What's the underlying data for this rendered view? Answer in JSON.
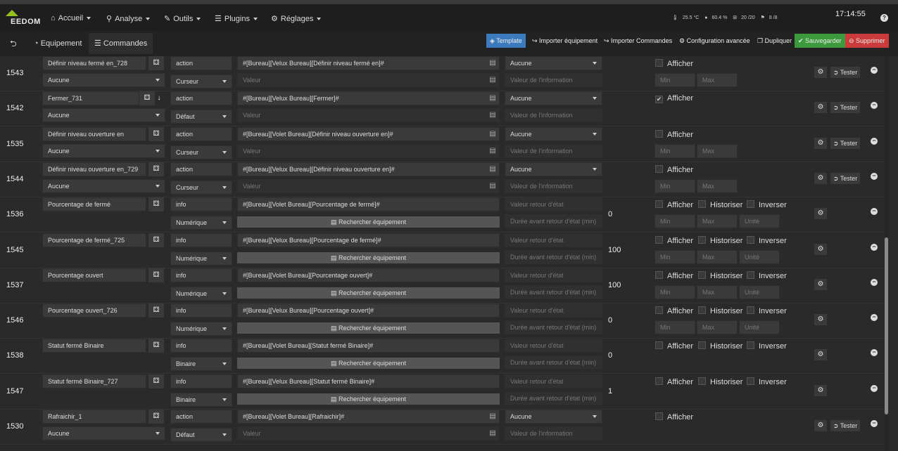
{
  "navbar": {
    "logo": "EEDOM",
    "menu": [
      {
        "label": "Accueil",
        "icon": "home-icon"
      },
      {
        "label": "Analyse",
        "icon": "analyse-icon"
      },
      {
        "label": "Outils",
        "icon": "wrench-icon"
      },
      {
        "label": "Plugins",
        "icon": "list-icon"
      },
      {
        "label": "Réglages",
        "icon": "gear-icon"
      }
    ],
    "stats": {
      "temperature": "25.5 °C",
      "humidity": "60.4 %",
      "equipments": "20 /20",
      "services": "8 /8"
    },
    "clock": "17:14:55",
    "help": "?"
  },
  "toolbar": {
    "tabs": [
      {
        "label": "Equipement",
        "icon": "dashboard-icon"
      },
      {
        "label": "Commandes",
        "icon": "list-icon"
      }
    ],
    "actions": [
      {
        "label": "Template",
        "color": "#3b7bbd"
      },
      {
        "label": "Importer équipement",
        "color": "#222222"
      },
      {
        "label": "Importer Commandes",
        "color": "#222222"
      },
      {
        "label": "Configuration avancée",
        "color": "#222222"
      },
      {
        "label": "Dupliquer",
        "color": "#222222"
      },
      {
        "label": "Sauvegarder",
        "color": "#3c9a3c"
      },
      {
        "label": "Supprimer",
        "color": "#cc3b3b"
      }
    ]
  },
  "labels": {
    "afficher": "Afficher",
    "historiser": "Historiser",
    "inverser": "Inverser",
    "tester": "Tester",
    "search": "Rechercher équipement",
    "valeur_ph": "Valeur",
    "info_ph": "Valeur de l'information",
    "retour_ph": "Valeur retour d'état",
    "duree_ph": "Durée avant retour d'état (min)",
    "min_ph": "Min",
    "max_ph": "Max",
    "unite_ph": "Unité"
  },
  "rows": [
    {
      "id": "1543",
      "name": "Définir niveau fermé en_728",
      "generic": "Aucune",
      "type": "action",
      "subtype": "Curseur",
      "logical": "#[Bureau][Velux Bureau][Définir niveau fermé en]#",
      "value_sel": "Aucune",
      "afficher": false,
      "arrow": false
    },
    {
      "id": "1542",
      "name": "Fermer_731",
      "generic": "Aucune",
      "type": "action",
      "subtype": "Défaut",
      "logical": "#[Bureau][Velux Bureau][Fermer]#",
      "value_sel": "Aucune",
      "afficher": true,
      "arrow": true
    },
    {
      "id": "1535",
      "name": "Définir niveau ouverture en",
      "generic": "Aucune",
      "type": "action",
      "subtype": "Curseur",
      "logical": "#[Bureau][Volet Bureau][Définir niveau ouverture en]#",
      "value_sel": "Aucune",
      "afficher": false,
      "arrow": false
    },
    {
      "id": "1544",
      "name": "Définir niveau ouverture en_729",
      "generic": "Aucune",
      "type": "action",
      "subtype": "Curseur",
      "logical": "#[Bureau][Velux Bureau][Définir niveau ouverture en]#",
      "value_sel": "Aucune",
      "afficher": false,
      "arrow": false
    },
    {
      "id": "1536",
      "name": "Pourcentage de fermé",
      "type": "info",
      "subtype": "Numérique",
      "logical": "#[Bureau][Volet Bureau][Pourcentage de fermé]#",
      "current": "0",
      "afficher": false,
      "historiser": false,
      "inverser": false,
      "minmax": true
    },
    {
      "id": "1545",
      "name": "Pourcentage de fermé_725",
      "type": "info",
      "subtype": "Numérique",
      "logical": "#[Bureau][Velux Bureau][Pourcentage de fermé]#",
      "current": "100",
      "afficher": false,
      "historiser": false,
      "inverser": false,
      "minmax": true
    },
    {
      "id": "1537",
      "name": "Pourcentage ouvert",
      "type": "info",
      "subtype": "Numérique",
      "logical": "#[Bureau][Volet Bureau][Pourcentage ouvert]#",
      "current": "100",
      "afficher": false,
      "historiser": false,
      "inverser": false,
      "minmax": true
    },
    {
      "id": "1546",
      "name": "Pourcentage ouvert_726",
      "type": "info",
      "subtype": "Numérique",
      "logical": "#[Bureau][Velux Bureau][Pourcentage ouvert]#",
      "current": "0",
      "afficher": false,
      "historiser": false,
      "inverser": false,
      "minmax": true
    },
    {
      "id": "1538",
      "name": "Statut fermé Binaire",
      "type": "info",
      "subtype": "Binaire",
      "logical": "#[Bureau][Volet Bureau][Statut fermé Binaire]#",
      "current": "0",
      "afficher": false,
      "historiser": false,
      "inverser": false,
      "minmax": false
    },
    {
      "id": "1547",
      "name": "Statut fermé Binaire_727",
      "type": "info",
      "subtype": "Binaire",
      "logical": "#[Bureau][Velux Bureau][Statut fermé Binaire]#",
      "current": "1",
      "afficher": false,
      "historiser": false,
      "inverser": false,
      "minmax": false
    },
    {
      "id": "1530",
      "name": "Rafraichir_1",
      "generic": "Aucune",
      "type": "action",
      "subtype": "Défaut",
      "logical": "#[Bureau][Volet Bureau][Rafraichir]#",
      "value_sel": "Aucune",
      "afficher": false,
      "arrow": false
    }
  ]
}
